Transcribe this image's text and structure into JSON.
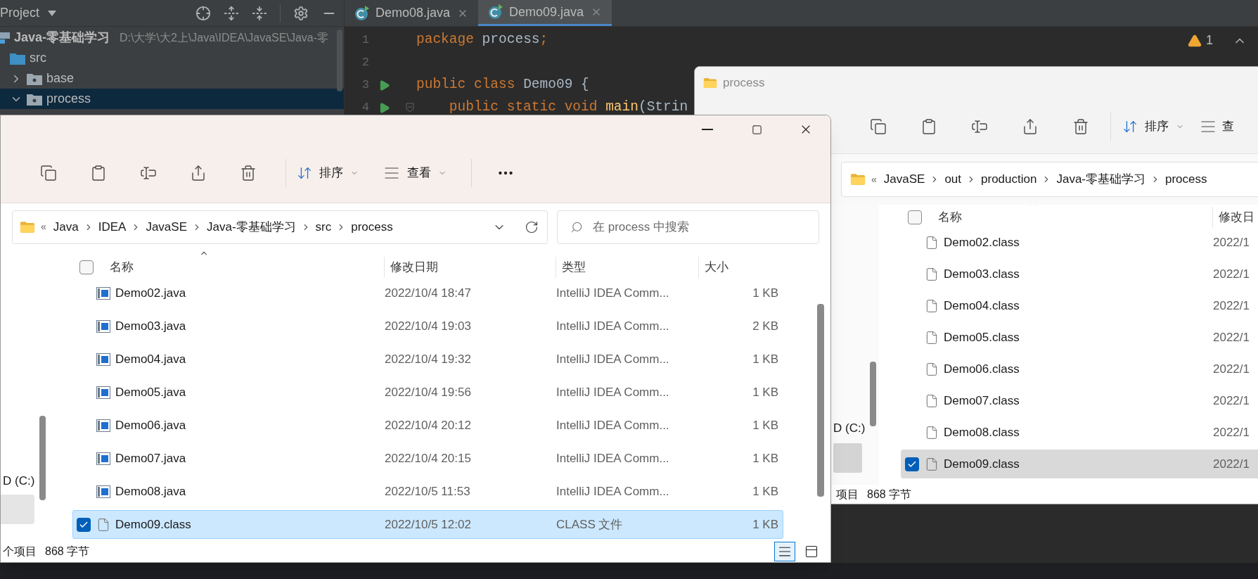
{
  "ide": {
    "project_panel": {
      "title": "Project",
      "tree": [
        {
          "label": "Java-零基础学习",
          "kind": "module",
          "path": "D:\\大学\\大2上\\Java\\IDEA\\JavaSE\\Java-零",
          "selected": false,
          "children": [
            {
              "label": "src",
              "kind": "source",
              "selected": false,
              "children": [
                {
                  "label": "base",
                  "kind": "package",
                  "expanded": false,
                  "selected": false
                },
                {
                  "label": "process",
                  "kind": "package",
                  "expanded": true,
                  "selected": true
                }
              ]
            }
          ]
        }
      ]
    },
    "tabs": [
      {
        "label": "Demo08.java",
        "selected": false
      },
      {
        "label": "Demo09.java",
        "selected": true
      }
    ],
    "warning_count": "1",
    "lines": [
      {
        "number": "1",
        "run": false,
        "fold": false,
        "tokens": [
          {
            "text": "package",
            "kind": "keyword"
          },
          {
            "text": " process",
            "kind": "plain"
          },
          {
            "text": ";",
            "kind": "keyword"
          }
        ]
      },
      {
        "number": "2",
        "run": false,
        "fold": false
      },
      {
        "number": "3",
        "run": true,
        "fold": false,
        "tokens": [
          {
            "text": "public class",
            "kind": "keyword"
          },
          {
            "text": " Demo09 {",
            "kind": "plain"
          }
        ]
      },
      {
        "number": "4",
        "run": true,
        "fold": true,
        "tokens": [
          {
            "text": "    public static void",
            "kind": "keyword"
          },
          {
            "text": " main",
            "kind": "method"
          },
          {
            "text": "(Strin",
            "kind": "plain"
          }
        ]
      }
    ]
  },
  "explorer_front": {
    "toolbar": {
      "sort": "排序",
      "view": "查看"
    },
    "address": {
      "prefix": "«",
      "crumbs": [
        "Java",
        "IDEA",
        "JavaSE",
        "Java-零基础学习",
        "src",
        "process"
      ]
    },
    "search": {
      "placeholder": "在 process 中搜索"
    },
    "nav": [
      "D (C:)"
    ],
    "columns": [
      "名称",
      "修改日期",
      "类型",
      "大小"
    ],
    "header_checked": false,
    "rows": [
      {
        "name": "Demo02.java",
        "kind": "java",
        "date": "2022/10/4 18:47",
        "type": "IntelliJ IDEA Comm...",
        "size": "1 KB",
        "selected": false
      },
      {
        "name": "Demo03.java",
        "kind": "java",
        "date": "2022/10/4 19:03",
        "type": "IntelliJ IDEA Comm...",
        "size": "2 KB",
        "selected": false
      },
      {
        "name": "Demo04.java",
        "kind": "java",
        "date": "2022/10/4 19:32",
        "type": "IntelliJ IDEA Comm...",
        "size": "1 KB",
        "selected": false
      },
      {
        "name": "Demo05.java",
        "kind": "java",
        "date": "2022/10/4 19:56",
        "type": "IntelliJ IDEA Comm...",
        "size": "1 KB",
        "selected": false
      },
      {
        "name": "Demo06.java",
        "kind": "java",
        "date": "2022/10/4 20:12",
        "type": "IntelliJ IDEA Comm...",
        "size": "1 KB",
        "selected": false
      },
      {
        "name": "Demo07.java",
        "kind": "java",
        "date": "2022/10/4 20:15",
        "type": "IntelliJ IDEA Comm...",
        "size": "1 KB",
        "selected": false
      },
      {
        "name": "Demo08.java",
        "kind": "java",
        "date": "2022/10/5 11:53",
        "type": "IntelliJ IDEA Comm...",
        "size": "1 KB",
        "selected": false
      },
      {
        "name": "Demo09.class",
        "kind": "class",
        "date": "2022/10/5 12:02",
        "type": "CLASS 文件",
        "size": "1 KB",
        "selected": true
      }
    ],
    "status": [
      "个项目",
      "868 字节"
    ],
    "view_buttons": [
      {
        "kind": "details",
        "selected": true
      },
      {
        "kind": "tiles",
        "selected": false
      }
    ]
  },
  "explorer_back": {
    "title": "process",
    "toolbar": {
      "sort": "排序",
      "view": "查"
    },
    "address": {
      "prefix": "«",
      "crumbs": [
        "JavaSE",
        "out",
        "production",
        "Java-零基础学习",
        "process"
      ]
    },
    "nav": [
      "D (C:)"
    ],
    "columns": [
      "名称",
      "修改日"
    ],
    "header_checked": false,
    "rows": [
      {
        "name": "Demo02.class",
        "kind": "class",
        "date": "2022/1",
        "selected": false
      },
      {
        "name": "Demo03.class",
        "kind": "class",
        "date": "2022/1",
        "selected": false
      },
      {
        "name": "Demo04.class",
        "kind": "class",
        "date": "2022/1",
        "selected": false
      },
      {
        "name": "Demo05.class",
        "kind": "class",
        "date": "2022/1",
        "selected": false
      },
      {
        "name": "Demo06.class",
        "kind": "class",
        "date": "2022/1",
        "selected": false
      },
      {
        "name": "Demo07.class",
        "kind": "class",
        "date": "2022/1",
        "selected": false
      },
      {
        "name": "Demo08.class",
        "kind": "class",
        "date": "2022/1",
        "selected": false
      },
      {
        "name": "Demo09.class",
        "kind": "class",
        "date": "2022/1",
        "selected": true
      }
    ],
    "status": [
      "项目",
      "868 字节"
    ]
  }
}
